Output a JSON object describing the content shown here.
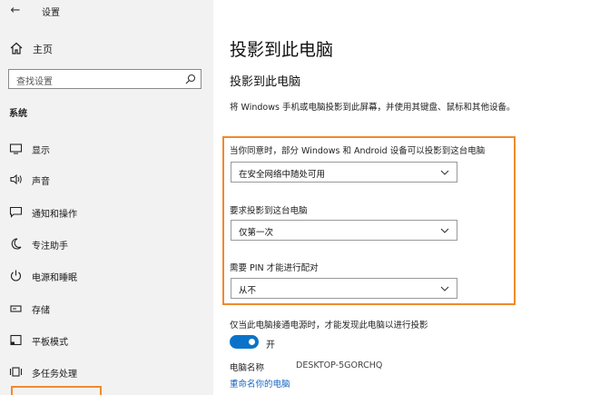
{
  "window": {
    "title": "设置"
  },
  "sidebar": {
    "home_label": "主页",
    "search_placeholder": "查找设置",
    "section_label": "系统",
    "items": [
      {
        "label": "显示",
        "icon": "monitor-icon"
      },
      {
        "label": "声音",
        "icon": "speaker-icon"
      },
      {
        "label": "通知和操作",
        "icon": "notification-icon"
      },
      {
        "label": "专注助手",
        "icon": "moon-icon"
      },
      {
        "label": "电源和睡眠",
        "icon": "power-icon"
      },
      {
        "label": "存储",
        "icon": "storage-icon"
      },
      {
        "label": "平板模式",
        "icon": "tablet-icon"
      },
      {
        "label": "多任务处理",
        "icon": "multitask-icon"
      }
    ]
  },
  "main": {
    "page_title": "投影到此电脑",
    "section_title": "投影到此电脑",
    "description": "将 Windows 手机或电脑投影到此屏幕，并使用其键盘、鼠标和其他设备。",
    "settings": [
      {
        "label": "当你同意时，部分 Windows 和 Android 设备可以投影到这台电脑",
        "value": "在安全网络中随处可用"
      },
      {
        "label": "要求投影到这台电脑",
        "value": "仅第一次"
      },
      {
        "label": "需要 PIN 才能进行配对",
        "value": "从不"
      }
    ],
    "power_note": "仅当此电脑接通电源时，才能发现此电脑以进行投影",
    "toggle_label": "开",
    "pc_name_label": "电脑名称",
    "pc_name_value": "DESKTOP-5GORCHQ",
    "rename_link": "重命名你的电脑"
  },
  "colors": {
    "accent": "#0a73c9",
    "highlight": "#f08a2c",
    "link": "#1565c0"
  }
}
